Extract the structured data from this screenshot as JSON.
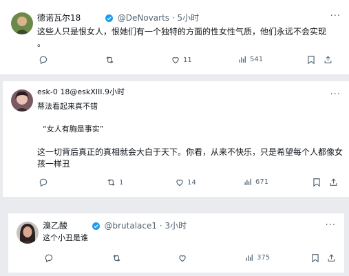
{
  "posts": [
    {
      "author": "德诺瓦尔18",
      "handle": "@DeNovarts",
      "sep": "·",
      "time": "5小时",
      "more": "···",
      "text_lines": [
        "这些人只是恨女人，恨她们有一个独特的方面的性女性气质，他们永远不会实现",
        "。"
      ],
      "replies": "",
      "reposts": "",
      "likes": "11",
      "views": "541"
    },
    {
      "author_line": "esk-0 18@eskXIII.9小时",
      "more": "···",
      "text_lines": [
        "蒂法看起来真不错",
        "“女人有胸是事实”",
        "这一切背后真正的真相就会大白于天下。你看，从来不快乐，只是希望每个人都像女",
        "孩一样丑"
      ],
      "replies": "",
      "reposts": "1",
      "likes": "14",
      "views": "671"
    },
    {
      "author": "溴乙酸",
      "handle": "@brutalace1",
      "sep": "·",
      "time": "3小时",
      "more": "···",
      "text_lines": [
        "这个小丑是谁"
      ],
      "replies": "",
      "reposts": "",
      "likes": "",
      "views": "375"
    }
  ],
  "colors": {
    "verified": "#1d9bf0",
    "muted": "#536471",
    "background": "#e9ebee"
  },
  "icons": [
    "reply-icon",
    "repost-icon",
    "like-icon",
    "views-icon",
    "bookmark-icon",
    "share-icon",
    "verified-badge-icon",
    "more-icon"
  ]
}
